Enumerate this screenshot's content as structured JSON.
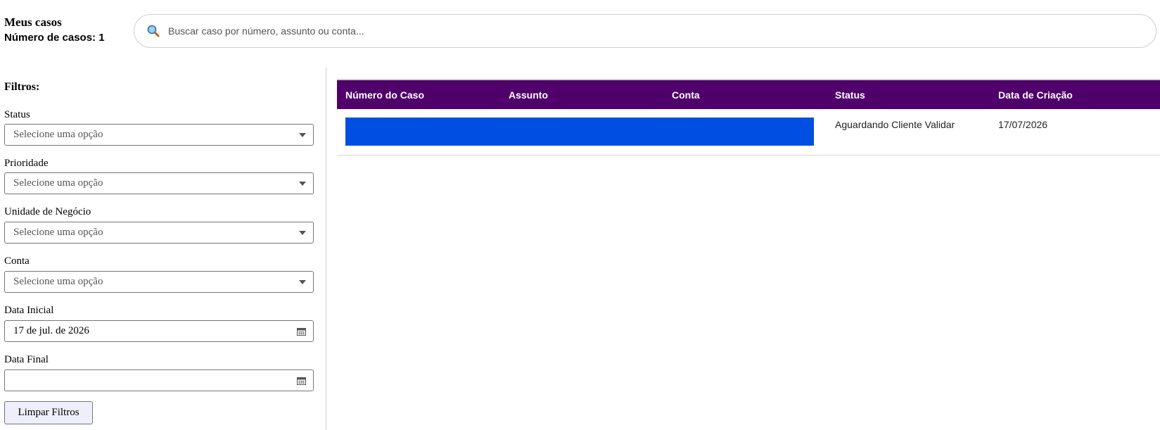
{
  "header": {
    "title": "Meus casos",
    "count_text": "Número de casos: 1"
  },
  "search": {
    "placeholder": "Buscar caso por número, assunto ou conta...",
    "value": ""
  },
  "filters": {
    "title": "Filtros:",
    "status": {
      "label": "Status",
      "value": "Selecione uma opção"
    },
    "priority": {
      "label": "Prioridade",
      "value": "Selecione uma opção"
    },
    "business_unit": {
      "label": "Unidade de Negócio",
      "value": "Selecione uma opção"
    },
    "account": {
      "label": "Conta",
      "value": "Selecione uma opção"
    },
    "start_date": {
      "label": "Data Inicial",
      "value": "17 de jul. de 2026"
    },
    "end_date": {
      "label": "Data Final",
      "value": ""
    },
    "clear_label": "Limpar Filtros"
  },
  "table": {
    "columns": [
      "Número do Caso",
      "Assunto",
      "Conta",
      "Status",
      "Data de Criação"
    ],
    "rows": [
      {
        "case_number": "",
        "subject": "",
        "account": "",
        "status": "Aguardando Cliente Validar",
        "created": "17/07/2026"
      }
    ]
  },
  "colors": {
    "header_bg": "#4f006b",
    "row_highlight": "#004fe3",
    "clear_button_bg": "#efeffb"
  },
  "icons": {
    "search": "search-icon",
    "select_caret": "chevron-down-icon",
    "calendar": "calendar-icon"
  }
}
